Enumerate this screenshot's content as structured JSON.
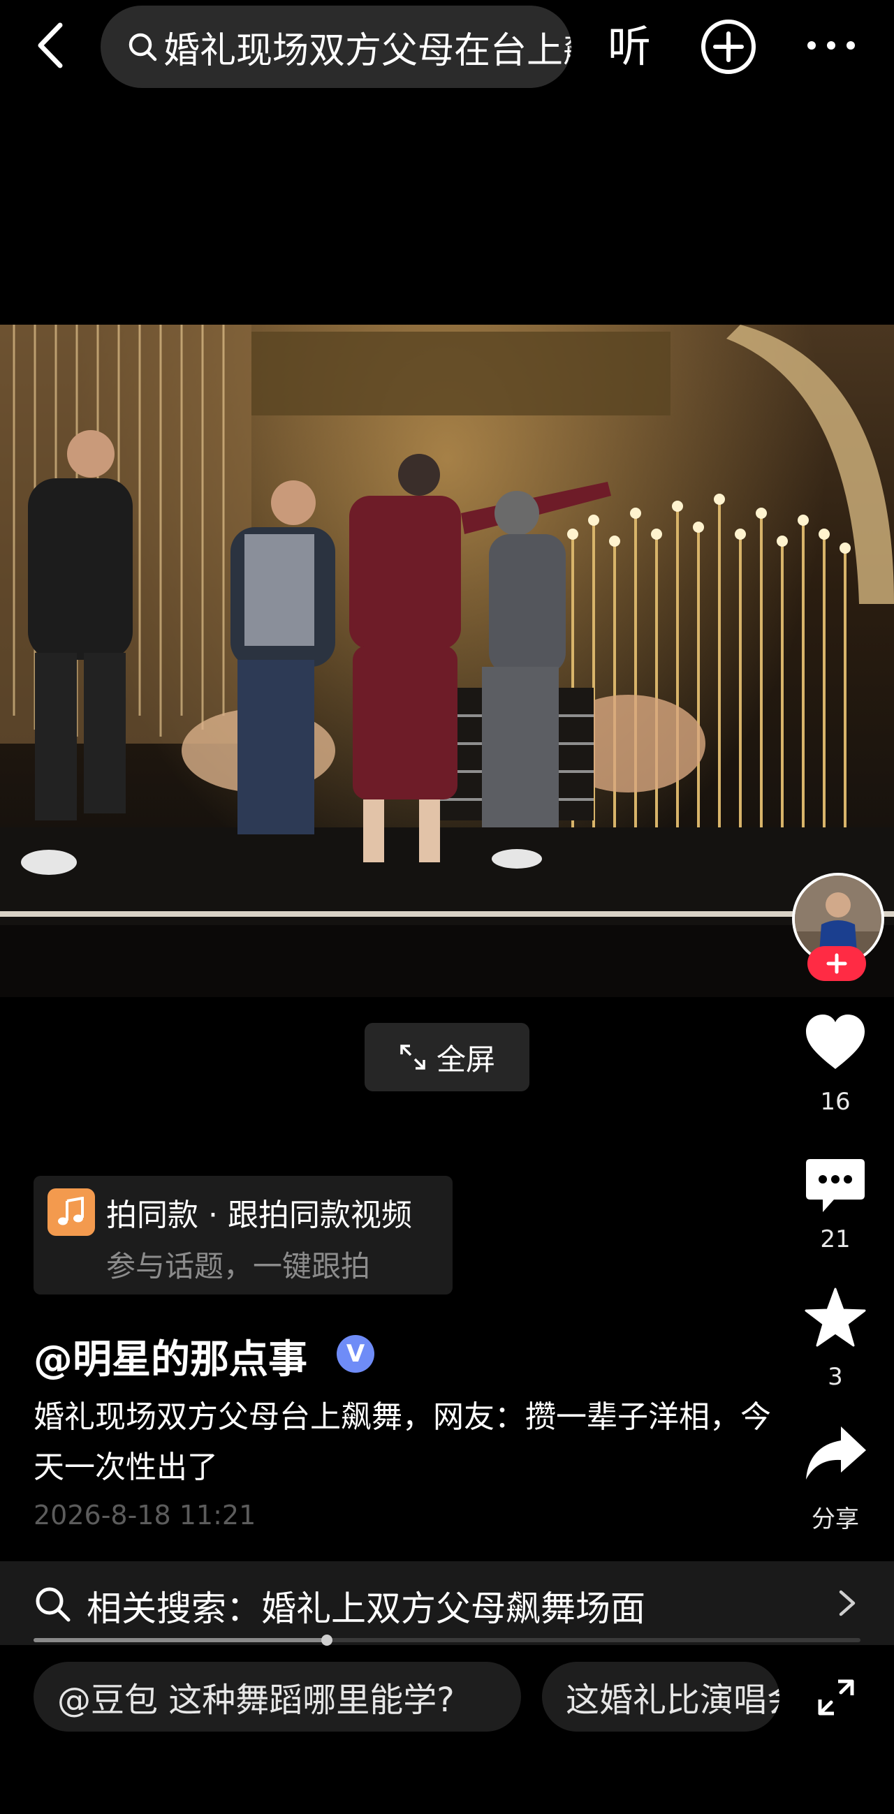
{
  "top_bar": {
    "search_text": "婚礼现场双方父母在台上飙舞",
    "listen_label": "听"
  },
  "video": {
    "fullscreen_label": "全屏"
  },
  "actions": {
    "likes": "16",
    "comments": "21",
    "favorites": "3",
    "share_label": "分享"
  },
  "same_style": {
    "title": "拍同款 · 跟拍同款视频",
    "subtitle": "参与话题，一键跟拍"
  },
  "post": {
    "author": "@明星的那点事",
    "verified_mark": "V",
    "caption": "婚礼现场双方父母台上飙舞，网友：攒一辈子洋相，今天一次性出了",
    "time": "2026-8-18 11:21"
  },
  "related_search": {
    "text": "相关搜索：婚礼上双方父母飙舞场面"
  },
  "suggestions": {
    "chip1": "@豆包 这种舞蹈哪里能学?",
    "chip2": "这婚礼比演唱会还热闹"
  },
  "colors": {
    "accent_red": "#ff2b44",
    "note_orange": "#f39a4e",
    "verified_blue": "#6f8cf7"
  },
  "icons": [
    "back-arrow-icon",
    "search-icon",
    "plus-circle-icon",
    "more-dots-icon",
    "heart-icon",
    "comment-icon",
    "star-icon",
    "share-icon",
    "expand-icon",
    "music-note-icon",
    "chevron-right-icon"
  ]
}
